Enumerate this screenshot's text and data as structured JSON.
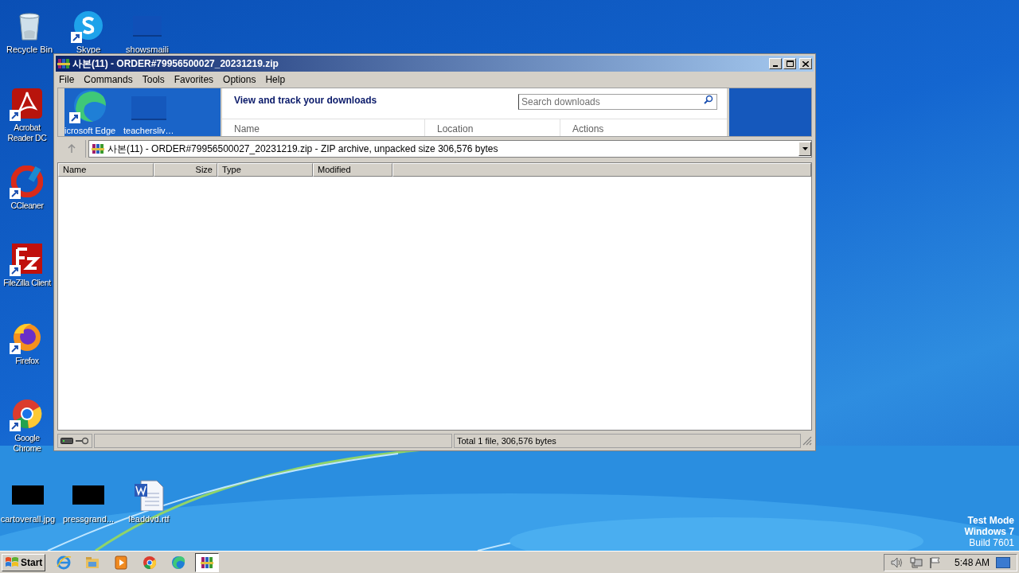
{
  "desktop": {
    "icons": [
      {
        "label": "Recycle Bin",
        "kind": "recycle",
        "shortcut": false
      },
      {
        "label": "Skype",
        "kind": "skype",
        "shortcut": true
      },
      {
        "label": "showsmaili",
        "kind": "blank",
        "shortcut": false
      },
      {
        "label": "Acrobat Reader DC",
        "kind": "acrobat",
        "shortcut": true
      },
      {
        "label": "CCleaner",
        "kind": "ccleaner",
        "shortcut": true
      },
      {
        "label": "FileZilla Client",
        "kind": "filezilla",
        "shortcut": true
      },
      {
        "label": "Firefox",
        "kind": "firefox",
        "shortcut": true
      },
      {
        "label": "Google Chrome",
        "kind": "chrome",
        "shortcut": true
      },
      {
        "label": "cartoverall.jpg",
        "kind": "thumb",
        "shortcut": false
      },
      {
        "label": "pressgrand...",
        "kind": "thumb",
        "shortcut": false
      },
      {
        "label": "leaddvd.rtf",
        "kind": "word",
        "shortcut": false
      }
    ],
    "os_info": [
      "Test Mode",
      "Windows 7",
      "Build 7601"
    ]
  },
  "window": {
    "title": "사본(11) - ORDER#79956500027_20231219.zip",
    "menu": [
      "File",
      "Commands",
      "Tools",
      "Favorites",
      "Options",
      "Help"
    ],
    "bleed": {
      "icon_labels": [
        "icrosoft Edge",
        "teachersliv…"
      ],
      "heading": "View and track your downloads",
      "search_placeholder": "Search downloads",
      "columns": [
        "Name",
        "Location",
        "Actions"
      ]
    },
    "address": "사본(11) - ORDER#79956500027_20231219.zip - ZIP archive, unpacked size 306,576 bytes",
    "columns": [
      "Name",
      "Size",
      "Type",
      "Modified"
    ],
    "status": "Total 1 file, 306,576 bytes"
  },
  "taskbar": {
    "start": "Start",
    "apps": [
      {
        "kind": "ie",
        "selected": false
      },
      {
        "kind": "explorer",
        "selected": false
      },
      {
        "kind": "media",
        "selected": false
      },
      {
        "kind": "chrome",
        "selected": false
      },
      {
        "kind": "edge",
        "selected": false
      },
      {
        "kind": "winrar",
        "selected": true
      }
    ],
    "time": "5:48 AM"
  }
}
